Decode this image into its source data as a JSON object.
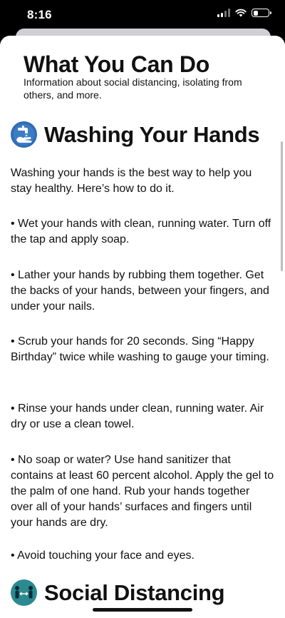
{
  "status_bar": {
    "time": "8:16",
    "battery_level": 0.35
  },
  "header": {
    "title": "What You Can Do",
    "subtitle": "Information about social distancing, isolating from others, and more."
  },
  "sections": [
    {
      "title": "Washing Your Hands",
      "icon": "hand-washing-icon",
      "icon_color": "#2f6db5",
      "paragraphs": [
        "Washing your hands is the best way to help you stay healthy. Here’s how to do it.",
        "• Wet your hands with clean, running water. Turn off the tap and apply soap.",
        "• Lather your hands by rubbing them together. Get the backs of your hands, between your fingers, and under your nails.",
        "• Scrub your hands for 20 seconds. Sing “Happy Birthday” twice while washing to gauge your timing.",
        "• Rinse your hands under clean, running water. Air dry or use a clean towel.",
        "• No soap or water? Use hand sanitizer that contains at least 60 percent alcohol. Apply the gel to the palm of one hand. Rub your hands together over all of your hands’ surfaces and fingers until your hands are dry.",
        "• Avoid touching your face and eyes."
      ]
    },
    {
      "title": "Social Distancing",
      "icon": "social-distancing-icon",
      "icon_color": "#2b8a8f"
    }
  ]
}
